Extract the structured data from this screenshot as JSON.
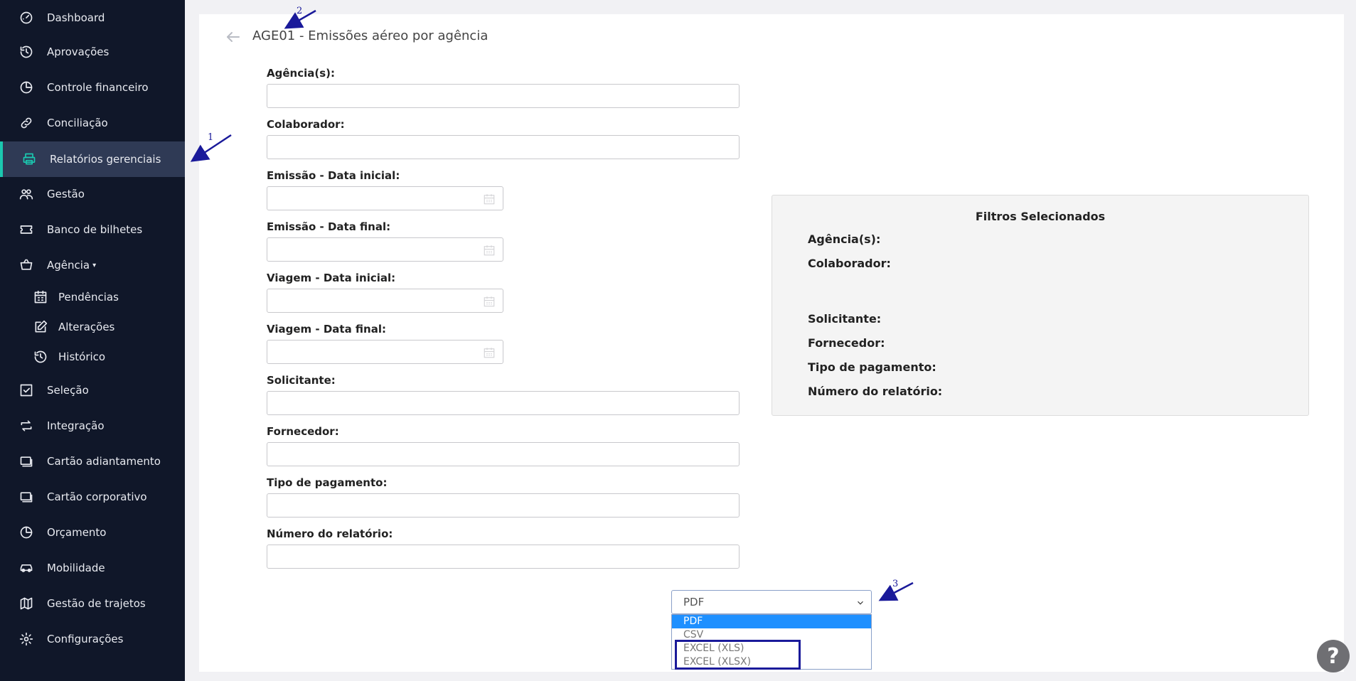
{
  "sidebar": {
    "items": [
      {
        "label": "Dashboard",
        "icon": "gauge-icon"
      },
      {
        "label": "Aprovações",
        "icon": "history-icon"
      },
      {
        "label": "Controle financeiro",
        "icon": "pie-chart-icon"
      },
      {
        "label": "Conciliação",
        "icon": "link-icon"
      },
      {
        "label": "Relatórios gerenciais",
        "icon": "printer-icon"
      },
      {
        "label": "Gestão",
        "icon": "users-icon"
      },
      {
        "label": "Banco de bilhetes",
        "icon": "ticket-icon"
      },
      {
        "label": "Agência",
        "icon": "basket-icon"
      },
      {
        "label": "Pendências",
        "icon": "calendar-grid-icon"
      },
      {
        "label": "Alterações",
        "icon": "edit-icon"
      },
      {
        "label": "Histórico",
        "icon": "history-icon"
      },
      {
        "label": "Seleção",
        "icon": "checkbox-icon"
      },
      {
        "label": "Integração",
        "icon": "repeat-icon"
      },
      {
        "label": "Cartão adiantamento",
        "icon": "cards-icon"
      },
      {
        "label": "Cartão corporativo",
        "icon": "cards-icon"
      },
      {
        "label": "Orçamento",
        "icon": "pie-chart-icon"
      },
      {
        "label": "Mobilidade",
        "icon": "car-icon"
      },
      {
        "label": "Gestão de trajetos",
        "icon": "map-icon"
      },
      {
        "label": "Configurações",
        "icon": "gear-icon"
      }
    ],
    "active": "Relatórios gerenciais"
  },
  "page": {
    "title": "AGE01 - Emissões aéreo por agência"
  },
  "form": {
    "agencias_label": "Agência(s):",
    "colaborador_label": "Colaborador:",
    "emissao_inicial_label": "Emissão - Data inicial:",
    "emissao_final_label": "Emissão - Data final:",
    "viagem_inicial_label": "Viagem - Data inicial:",
    "viagem_final_label": "Viagem - Data final:",
    "solicitante_label": "Solicitante:",
    "fornecedor_label": "Fornecedor:",
    "tipo_pagamento_label": "Tipo de pagamento:",
    "numero_relatorio_label": "Número do relatório:"
  },
  "filters": {
    "title": "Filtros Selecionados",
    "rows": [
      "Agência(s):",
      "Colaborador:",
      "Solicitante:",
      "Fornecedor:",
      "Tipo de pagamento:",
      "Número do relatório:"
    ]
  },
  "format_select": {
    "value": "PDF",
    "options": [
      "PDF",
      "CSV",
      "EXCEL (XLS)",
      "EXCEL (XLSX)"
    ]
  },
  "annotations": [
    "1",
    "2",
    "3"
  ],
  "help": {
    "label": "?"
  },
  "colors": {
    "sidebar_bg": "#101729",
    "active_accent": "#1bc8b0",
    "annotation": "#1a1a9a",
    "selected_option": "#1e90ff"
  }
}
